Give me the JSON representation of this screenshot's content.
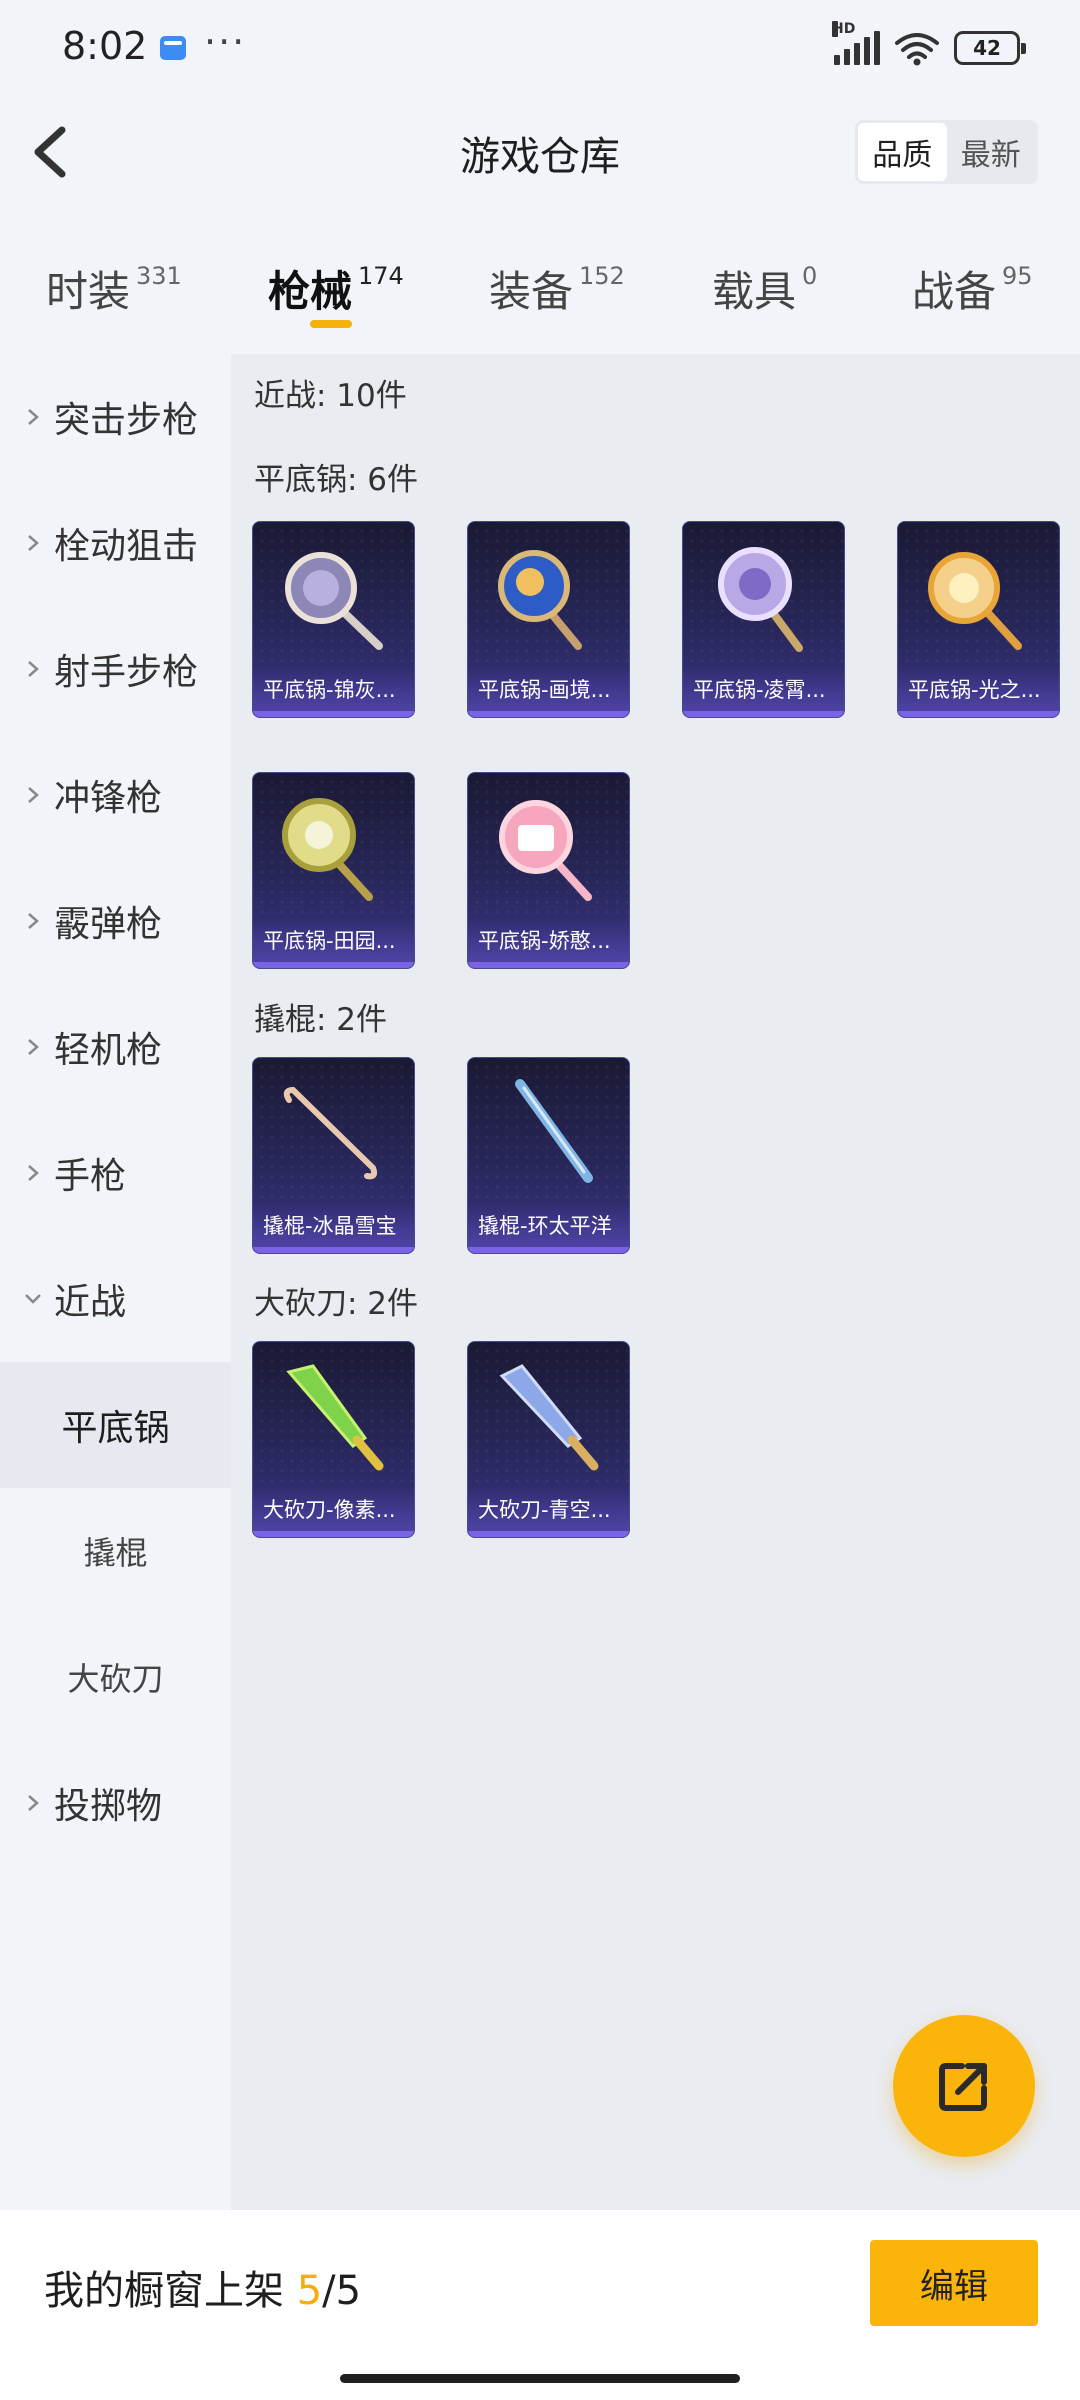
{
  "status_bar": {
    "time": "8:02",
    "more": "···",
    "battery": "42",
    "network": "HD"
  },
  "header": {
    "title": "游戏仓库",
    "sort_options": [
      "品质",
      "最新"
    ],
    "active_sort": "品质"
  },
  "tabs": [
    {
      "label": "时装",
      "count": "331"
    },
    {
      "label": "枪械",
      "count": "174"
    },
    {
      "label": "装备",
      "count": "152"
    },
    {
      "label": "载具",
      "count": "0"
    },
    {
      "label": "战备",
      "count": "95"
    }
  ],
  "active_tab": "枪械",
  "sidebar": {
    "items": [
      "突击步枪",
      "栓动狙击",
      "射手步枪",
      "冲锋枪",
      "霰弹枪",
      "轻机枪",
      "手枪",
      "近战"
    ],
    "subitems": [
      "平底锅",
      "撬棍",
      "大砍刀"
    ],
    "after": "投掷物",
    "active": "平底锅"
  },
  "content": {
    "summary": "近战: 10件",
    "sections": [
      {
        "title": "平底锅: 6件",
        "items": [
          "平底锅-锦灰...",
          "平底锅-画境...",
          "平底锅-凌霄...",
          "平底锅-光之...",
          "平底锅-田园...",
          "平底锅-娇憨..."
        ]
      },
      {
        "title": "撬棍: 2件",
        "items": [
          "撬棍-冰晶雪宝",
          "撬棍-环太平洋"
        ]
      },
      {
        "title": "大砍刀: 2件",
        "items": [
          "大砍刀-像素...",
          "大砍刀-青空..."
        ]
      }
    ]
  },
  "bottom_bar": {
    "showcase_label": "我的橱窗上架",
    "showcase_current": "5",
    "showcase_total": "/5",
    "edit_label": "编辑"
  },
  "colors": {
    "accent": "#fbb50a",
    "page_bg": "#f1f4f9",
    "content_bg": "#e9ecf1",
    "card_bg": "#28275a"
  }
}
